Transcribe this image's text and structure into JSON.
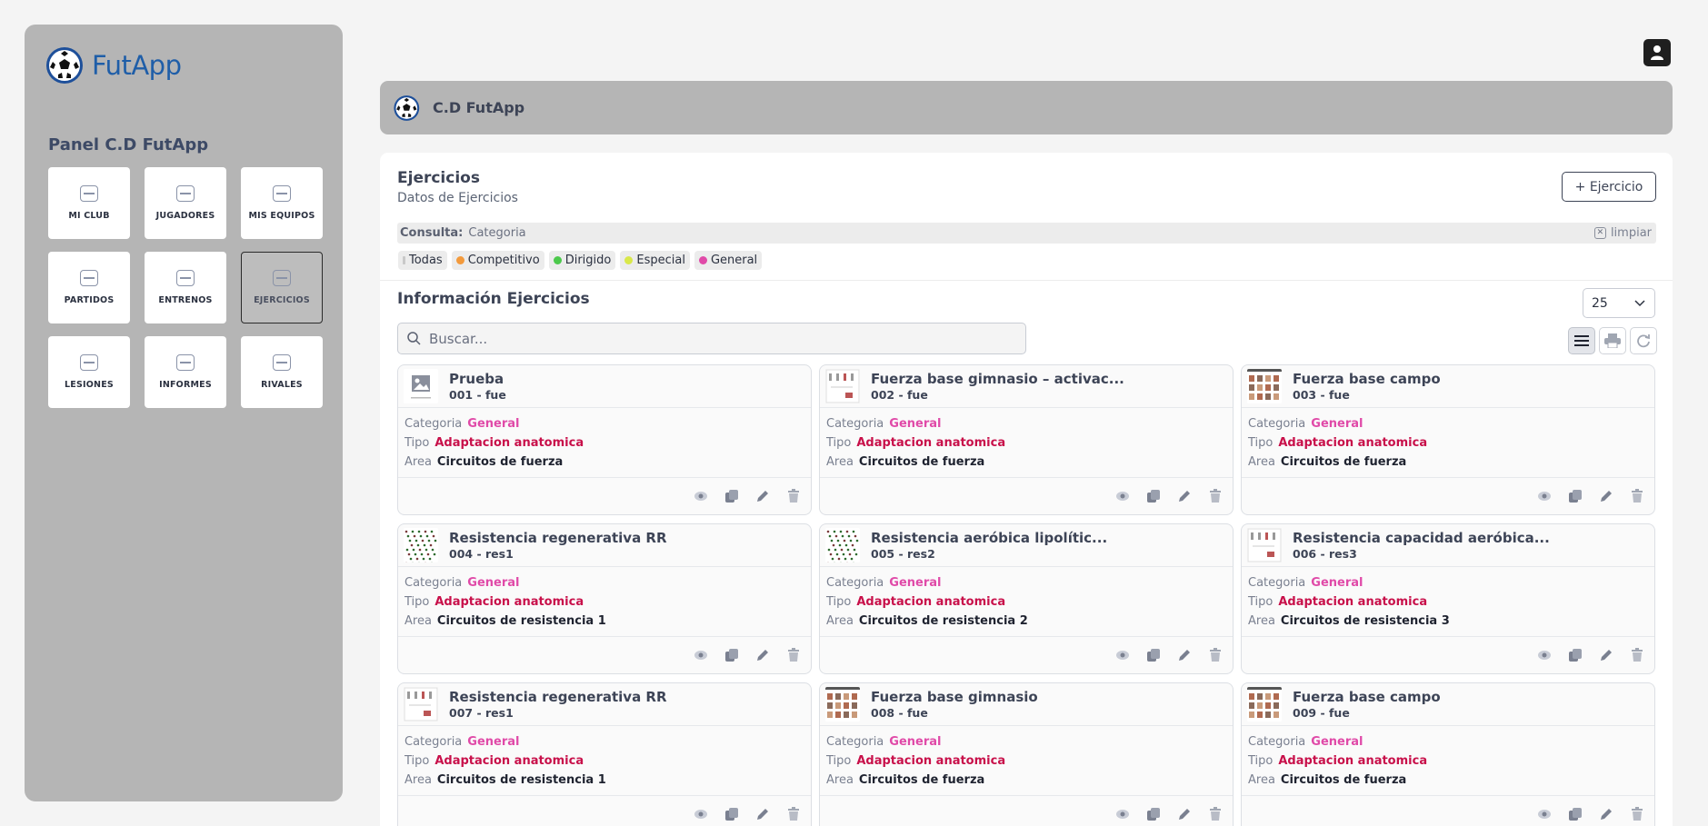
{
  "app": {
    "logo_text": "FutApp",
    "panel_title": "Panel C.D FutApp"
  },
  "sidebar": {
    "tiles": [
      {
        "label": "MI CLUB"
      },
      {
        "label": "JUGADORES"
      },
      {
        "label": "MIS EQUIPOS"
      },
      {
        "label": "PARTIDOS"
      },
      {
        "label": "ENTRENOS"
      },
      {
        "label": "EJERCICIOS",
        "active": true
      },
      {
        "label": "LESIONES"
      },
      {
        "label": "INFORMES"
      },
      {
        "label": "RIVALES"
      }
    ]
  },
  "club": {
    "name": "C.D FutApp"
  },
  "header": {
    "title": "Ejercicios",
    "subtitle": "Datos de Ejercicios",
    "add_button": "+ Ejercicio"
  },
  "query": {
    "label": "Consulta:",
    "value": "Categoria",
    "clear_label": "limpiar"
  },
  "filters": [
    {
      "label": "Todas",
      "color": "#c8c8c8"
    },
    {
      "label": "Competitivo",
      "color": "#f39a3c"
    },
    {
      "label": "Dirigido",
      "color": "#4cc94c"
    },
    {
      "label": "Especial",
      "color": "#d9e84a"
    },
    {
      "label": "General",
      "color": "#e04aa8"
    }
  ],
  "list": {
    "title": "Información Ejercicios",
    "page_size": "25",
    "search_placeholder": "Buscar..."
  },
  "labels": {
    "categoria": "Categoria",
    "tipo": "Tipo",
    "area": "Area"
  },
  "cards": [
    {
      "name": "Prueba",
      "code": "001 - fue",
      "categoria": "General",
      "tipo": "Adaptacion anatomica",
      "area": "Circuitos de fuerza"
    },
    {
      "name": "Fuerza base gimnasio – activac...",
      "code": "002 - fue",
      "categoria": "General",
      "tipo": "Adaptacion anatomica",
      "area": "Circuitos de fuerza"
    },
    {
      "name": "Fuerza base campo",
      "code": "003 - fue",
      "categoria": "General",
      "tipo": "Adaptacion anatomica",
      "area": "Circuitos de fuerza"
    },
    {
      "name": "Resistencia regenerativa RR",
      "code": "004 - res1",
      "categoria": "General",
      "tipo": "Adaptacion anatomica",
      "area": "Circuitos de resistencia 1"
    },
    {
      "name": "Resistencia aeróbica lipolític...",
      "code": "005 - res2",
      "categoria": "General",
      "tipo": "Adaptacion anatomica",
      "area": "Circuitos de resistencia 2"
    },
    {
      "name": "Resistencia capacidad aeróbica...",
      "code": "006 - res3",
      "categoria": "General",
      "tipo": "Adaptacion anatomica",
      "area": "Circuitos de resistencia 3"
    },
    {
      "name": "Resistencia regenerativa RR",
      "code": "007 - res1",
      "categoria": "General",
      "tipo": "Adaptacion anatomica",
      "area": "Circuitos de resistencia 1"
    },
    {
      "name": "Fuerza base gimnasio",
      "code": "008 - fue",
      "categoria": "General",
      "tipo": "Adaptacion anatomica",
      "area": "Circuitos de fuerza"
    },
    {
      "name": "Fuerza base campo",
      "code": "009 - fue",
      "categoria": "General",
      "tipo": "Adaptacion anatomica",
      "area": "Circuitos de fuerza"
    }
  ]
}
